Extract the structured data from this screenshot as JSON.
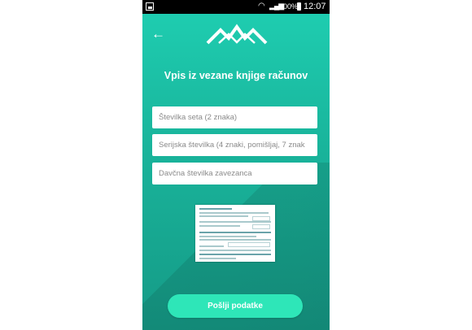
{
  "status_bar": {
    "battery_percent": "100%",
    "time": "12:07"
  },
  "header": {
    "back_icon": "arrow-left-icon",
    "logo_icon": "mountains-logo-icon"
  },
  "form": {
    "title": "Vpis iz vezane knjige računov",
    "fields": [
      {
        "placeholder": "Številka seta (2 znaka)",
        "value": ""
      },
      {
        "placeholder": "Serijska številka (4 znaki, pomišljaj, 7 znak",
        "value": ""
      },
      {
        "placeholder": "Davčna številka zavezanca",
        "value": ""
      }
    ],
    "submit_label": "Pošlji podatke"
  },
  "colors": {
    "background_top": "#1fcfb2",
    "background_bottom": "#159a86",
    "button": "#2ee6b8"
  }
}
